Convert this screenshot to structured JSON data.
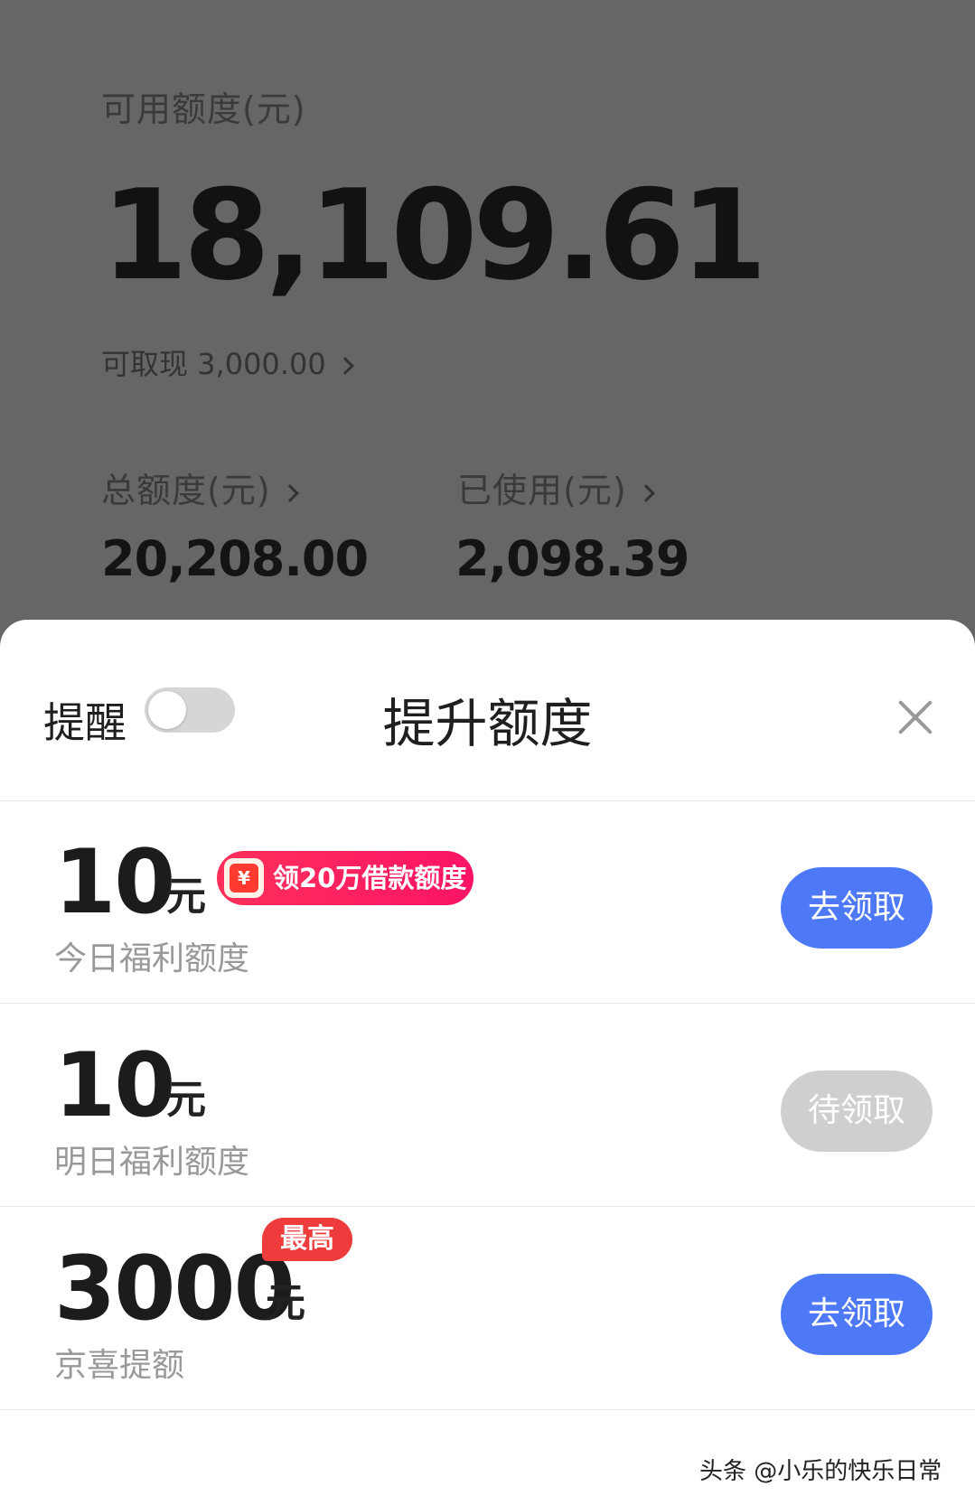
{
  "background": {
    "available_label": "可用额度(元)",
    "available_amount": "18,109.61",
    "withdrawable_label": "可取现 3,000.00",
    "total_label": "总额度(元)",
    "total_value": "20,208.00",
    "used_label": "已使用(元)",
    "used_value": "2,098.39"
  },
  "sheet": {
    "remind_label": "提醒",
    "remind_enabled": false,
    "title": "提升额度",
    "rows": [
      {
        "amount": "10",
        "unit": "元",
        "badge_text": "领20万借款额度",
        "label": "今日福利额度",
        "button": "去领取",
        "button_state": "active"
      },
      {
        "amount": "10",
        "unit": "元",
        "label": "明日福利额度",
        "button": "待领取",
        "button_state": "disabled"
      },
      {
        "amount": "3000",
        "unit": "元",
        "badge_text": "最高",
        "label": "京喜提额",
        "button": "去领取",
        "button_state": "active"
      }
    ]
  },
  "watermark": "头条 @小乐的快乐日常",
  "colors": {
    "primary_button": "#4d79f6",
    "disabled_button": "#cfcfcf",
    "promo_badge": "#ff2f5a",
    "max_badge": "#ee3b3b",
    "overlay": "#666666"
  }
}
